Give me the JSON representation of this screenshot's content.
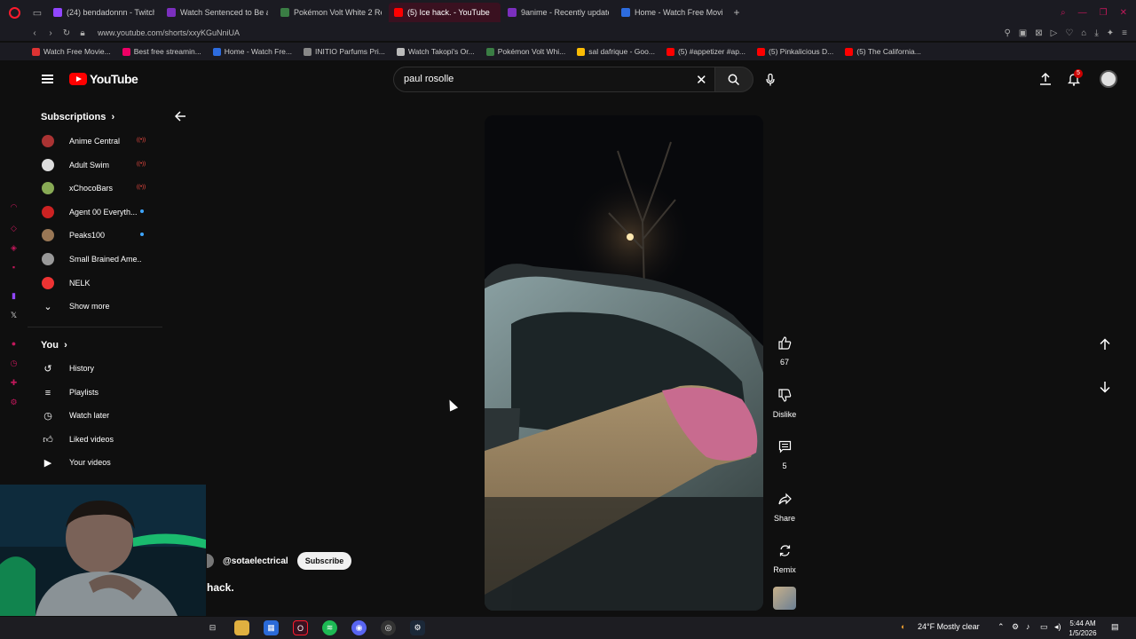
{
  "browser": {
    "tabs": [
      {
        "title": "(24) bendadonnn - Twitch",
        "color": "#9146ff",
        "active": false
      },
      {
        "title": "Watch Sentenced to Be a",
        "color": "#7b2fbe",
        "active": false
      },
      {
        "title": "Pokémon Volt White 2 Re",
        "color": "#3a7d44",
        "active": false
      },
      {
        "title": "(5) Ice hack. - YouTube",
        "color": "#ff0000",
        "active": true
      },
      {
        "title": "9anime - Recently update",
        "color": "#7b2fbe",
        "active": false
      },
      {
        "title": "Home - Watch Free Movie",
        "color": "#2d6cdf",
        "active": false
      }
    ],
    "url": "www.youtube.com/shorts/xxyKGuNniUA",
    "bookmarks": [
      {
        "label": "Watch Free Movie...",
        "color": "#d33"
      },
      {
        "label": "Best free streamin...",
        "color": "#e06"
      },
      {
        "label": "Home - Watch Fre...",
        "color": "#2d6cdf"
      },
      {
        "label": "INITIO Parfums Pri...",
        "color": "#888"
      },
      {
        "label": "Watch Takopi's Or...",
        "color": "#bbb"
      },
      {
        "label": "Pokémon Volt Whi...",
        "color": "#3a7d44"
      },
      {
        "label": "sal dafrique - Goo...",
        "color": "#fbbc05"
      },
      {
        "label": "(5) #appetizer #ap...",
        "color": "#ff0000"
      },
      {
        "label": "(5) Pinkalicious D...",
        "color": "#ff0000"
      },
      {
        "label": "(5) The California...",
        "color": "#ff0000"
      }
    ]
  },
  "youtube": {
    "logo_text": "YouTube",
    "search_query": "paul rosolle",
    "notification_count": "5"
  },
  "guide": {
    "subscriptions_header": "Subscriptions",
    "subscriptions": [
      {
        "name": "Anime Central",
        "status": "live",
        "color": "#a33"
      },
      {
        "name": "Adult Swim",
        "status": "live",
        "color": "#ddd"
      },
      {
        "name": "xChocoBars",
        "status": "live",
        "color": "#8a5"
      },
      {
        "name": "Agent 00 Everyth...",
        "status": "new",
        "color": "#c22"
      },
      {
        "name": "Peaks100",
        "status": "new",
        "color": "#975"
      },
      {
        "name": "Small Brained Ame...",
        "status": "none",
        "color": "#999"
      },
      {
        "name": "NELK",
        "status": "none",
        "color": "#e33"
      }
    ],
    "show_more": "Show more",
    "you_header": "You",
    "you_items": [
      {
        "label": "History",
        "icon": "history-icon"
      },
      {
        "label": "Playlists",
        "icon": "playlists-icon"
      },
      {
        "label": "Watch later",
        "icon": "watch-later-icon"
      },
      {
        "label": "Liked videos",
        "icon": "liked-videos-icon"
      },
      {
        "label": "Your videos",
        "icon": "your-videos-icon"
      }
    ]
  },
  "short": {
    "channel": "@sotaelectrical",
    "subscribe_label": "Subscribe",
    "title": "hack.",
    "likes": "67",
    "dislike_label": "Dislike",
    "comments": "5",
    "share_label": "Share",
    "remix_label": "Remix"
  },
  "taskbar": {
    "weather": "24°F  Mostly clear",
    "time": "5:44 AM",
    "date": "1/5/2026"
  }
}
